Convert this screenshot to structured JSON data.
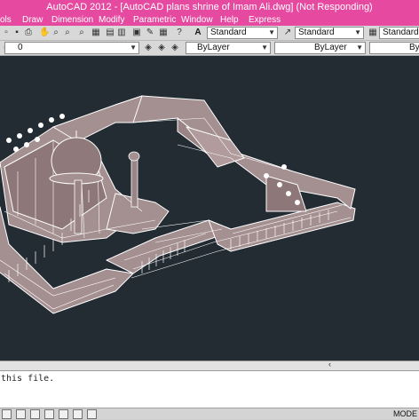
{
  "window": {
    "title": "AutoCAD 2012 - [AutoCAD plans shrine of Imam Ali.dwg] (Not Responding)"
  },
  "menu": [
    {
      "label": "ols"
    },
    {
      "label": "Draw"
    },
    {
      "label": "Dimension"
    },
    {
      "label": "Modify"
    },
    {
      "label": "Parametric"
    },
    {
      "label": "Window"
    },
    {
      "label": "Help"
    },
    {
      "label": "Express"
    }
  ],
  "toolbar": {
    "text_style": "Standard",
    "dim_style": "Standard",
    "table_style": "Standard",
    "layer": "0",
    "color": "ByLayer",
    "linetype": "ByLayer",
    "lineweight": "ByLayer"
  },
  "command_line": {
    "history": "this file."
  },
  "status": {
    "model_label": "MODE"
  },
  "colors": {
    "titlebar": "#e64aa0",
    "canvas": "#232b33",
    "building_fill": "#a48f91",
    "building_edge": "#ffffff"
  }
}
